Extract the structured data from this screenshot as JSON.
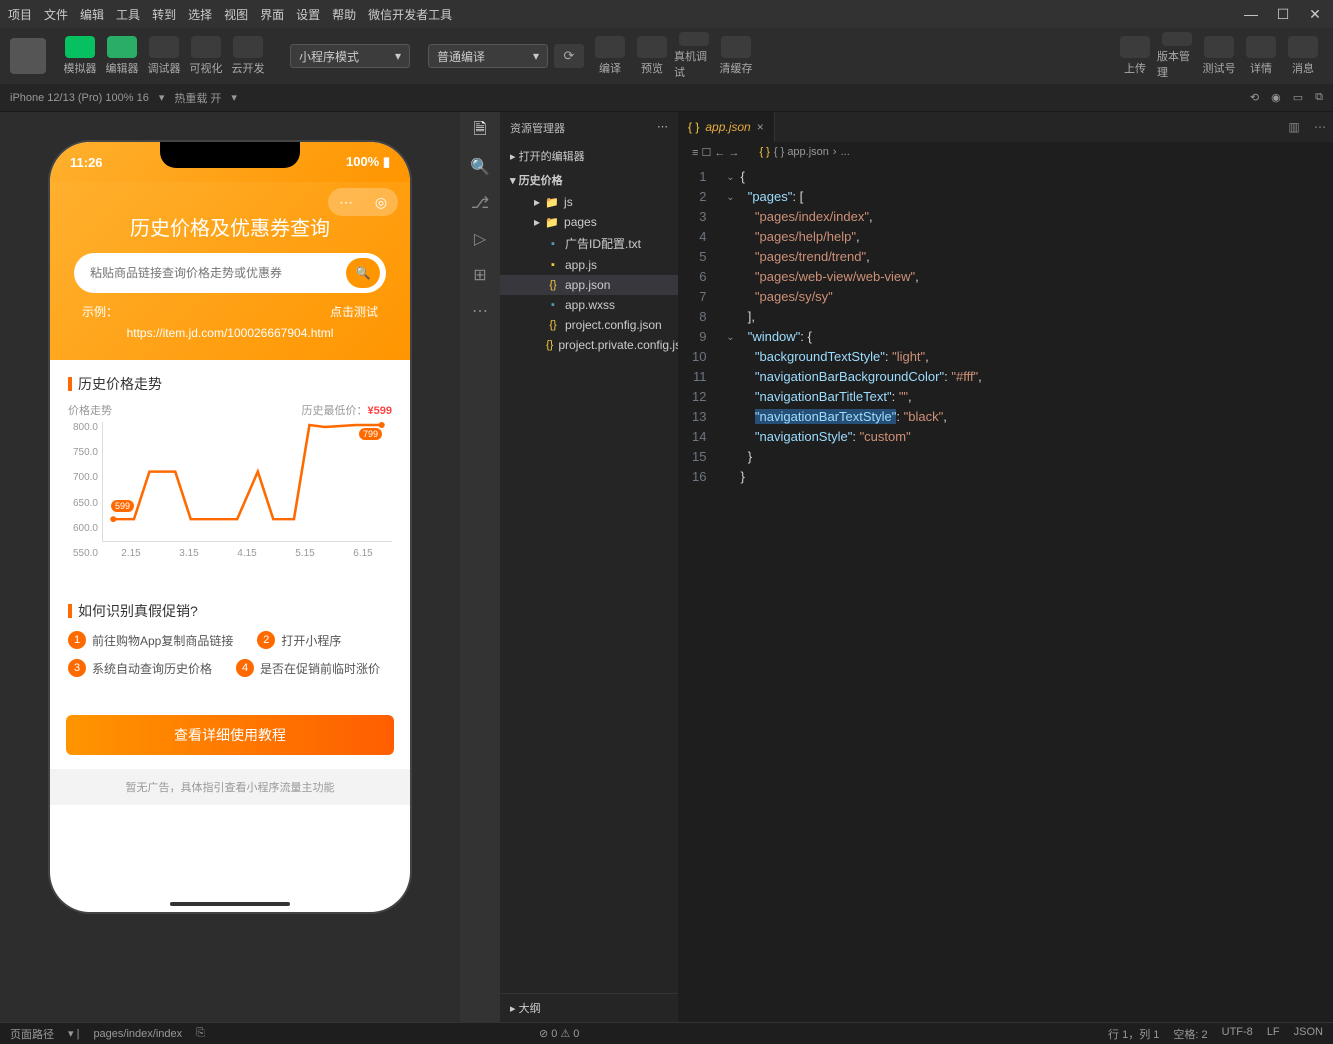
{
  "menu": [
    "项目",
    "文件",
    "编辑",
    "工具",
    "转到",
    "选择",
    "视图",
    "界面",
    "设置",
    "帮助",
    "微信开发者工具"
  ],
  "toolbar": {
    "buttons": [
      {
        "label": "模拟器",
        "cls": "green"
      },
      {
        "label": "编辑器",
        "cls": "green2"
      },
      {
        "label": "调试器",
        "cls": "dim"
      },
      {
        "label": "可视化",
        "cls": "dim"
      },
      {
        "label": "云开发",
        "cls": "dim"
      }
    ],
    "mode": "小程序模式",
    "compile": "普通编译",
    "actions": [
      {
        "label": "编译"
      },
      {
        "label": "预览"
      },
      {
        "label": "真机调试"
      },
      {
        "label": "清缓存"
      }
    ],
    "right": [
      {
        "label": "上传"
      },
      {
        "label": "版本管理"
      },
      {
        "label": "测试号"
      },
      {
        "label": "详情"
      },
      {
        "label": "消息"
      }
    ]
  },
  "subbar": {
    "device": "iPhone 12/13 (Pro) 100% 16",
    "reload": "热重载 开"
  },
  "simulator": {
    "time": "11:26",
    "battery": "100%",
    "title": "历史价格及优惠券查询",
    "search_placeholder": "粘贴商品链接查询价格走势或优惠券",
    "example_label": "示例：",
    "test_btn": "点击测试",
    "example_url": "https://item.jd.com/100026667904.html",
    "card1_title": "历史价格走势",
    "chart_title": "价格走势",
    "chart_min_label": "历史最低价：",
    "chart_min_price": "¥599",
    "card2_title": "如何识别真假促销?",
    "steps": [
      "前往购物App复制商品链接",
      "打开小程序",
      "系统自动查询历史价格",
      "是否在促销前临时涨价"
    ],
    "detail_btn": "查看详细使用教程",
    "ad_note": "暂无广告，具体指引查看小程序流量主功能"
  },
  "chart_data": {
    "type": "line",
    "title": "价格走势",
    "ylabel": "价格",
    "ylim": [
      550,
      800
    ],
    "categories": [
      "2.15",
      "3.15",
      "4.15",
      "5.15",
      "6.15"
    ],
    "values": [
      599,
      700,
      700,
      600,
      600,
      600,
      700,
      600,
      600,
      800,
      799,
      800,
      800
    ],
    "lowest": 599,
    "last": 799,
    "annotations": [
      {
        "label": "599",
        "x": 0,
        "y": 599
      },
      {
        "label": "799",
        "x": 11,
        "y": 799
      }
    ],
    "y_ticks": [
      "800.0",
      "750.0",
      "700.0",
      "650.0",
      "600.0",
      "550.0"
    ]
  },
  "explorer": {
    "title": "资源管理器",
    "sections": [
      "打开的编辑器",
      "历史价格"
    ],
    "tree": [
      {
        "label": "js",
        "icon": "folder-y",
        "indent": "indent1",
        "chev": "▸"
      },
      {
        "label": "pages",
        "icon": "folder-o",
        "indent": "indent1",
        "chev": "▸"
      },
      {
        "label": "广告ID配置.txt",
        "icon": "txt",
        "indent": "indent2"
      },
      {
        "label": "app.js",
        "icon": "js",
        "indent": "indent2"
      },
      {
        "label": "app.json",
        "icon": "json",
        "indent": "indent2",
        "active": true
      },
      {
        "label": "app.wxss",
        "icon": "wxss",
        "indent": "indent2"
      },
      {
        "label": "project.config.json",
        "icon": "json",
        "indent": "indent2"
      },
      {
        "label": "project.private.config.js...",
        "icon": "json",
        "indent": "indent2"
      }
    ],
    "outline": "大纲"
  },
  "editor": {
    "tab": "app.json",
    "breadcrumb": [
      "{ } app.json",
      "..."
    ],
    "code": [
      {
        "n": 1,
        "indent": 0,
        "tokens": [
          {
            "t": "brace",
            "v": "{"
          }
        ]
      },
      {
        "n": 2,
        "indent": 1,
        "tokens": [
          {
            "t": "key",
            "v": "\"pages\""
          },
          {
            "t": "punc",
            "v": ": ["
          }
        ]
      },
      {
        "n": 3,
        "indent": 2,
        "tokens": [
          {
            "t": "str",
            "v": "\"pages/index/index\""
          },
          {
            "t": "punc",
            "v": ","
          }
        ]
      },
      {
        "n": 4,
        "indent": 2,
        "tokens": [
          {
            "t": "str",
            "v": "\"pages/help/help\""
          },
          {
            "t": "punc",
            "v": ","
          }
        ]
      },
      {
        "n": 5,
        "indent": 2,
        "tokens": [
          {
            "t": "str",
            "v": "\"pages/trend/trend\""
          },
          {
            "t": "punc",
            "v": ","
          }
        ]
      },
      {
        "n": 6,
        "indent": 2,
        "tokens": [
          {
            "t": "str",
            "v": "\"pages/web-view/web-view\""
          },
          {
            "t": "punc",
            "v": ","
          }
        ]
      },
      {
        "n": 7,
        "indent": 2,
        "tokens": [
          {
            "t": "str",
            "v": "\"pages/sy/sy\""
          }
        ]
      },
      {
        "n": 8,
        "indent": 1,
        "tokens": [
          {
            "t": "punc",
            "v": "],"
          }
        ]
      },
      {
        "n": 9,
        "indent": 1,
        "tokens": [
          {
            "t": "key",
            "v": "\"window\""
          },
          {
            "t": "punc",
            "v": ": {"
          }
        ]
      },
      {
        "n": 10,
        "indent": 2,
        "tokens": [
          {
            "t": "key",
            "v": "\"backgroundTextStyle\""
          },
          {
            "t": "punc",
            "v": ": "
          },
          {
            "t": "str",
            "v": "\"light\""
          },
          {
            "t": "punc",
            "v": ","
          }
        ]
      },
      {
        "n": 11,
        "indent": 2,
        "tokens": [
          {
            "t": "key",
            "v": "\"navigationBarBackgroundColor\""
          },
          {
            "t": "punc",
            "v": ": "
          },
          {
            "t": "str",
            "v": "\"#fff\""
          },
          {
            "t": "punc",
            "v": ","
          }
        ]
      },
      {
        "n": 12,
        "indent": 2,
        "tokens": [
          {
            "t": "key",
            "v": "\"navigationBarTitleText\""
          },
          {
            "t": "punc",
            "v": ": "
          },
          {
            "t": "str",
            "v": "\"\""
          },
          {
            "t": "punc",
            "v": ","
          }
        ]
      },
      {
        "n": 13,
        "indent": 2,
        "tokens": [
          {
            "t": "key",
            "v": "\"navigationBarTextStyle\"",
            "hl": true
          },
          {
            "t": "punc",
            "v": ": "
          },
          {
            "t": "str",
            "v": "\"black\""
          },
          {
            "t": "punc",
            "v": ","
          }
        ]
      },
      {
        "n": 14,
        "indent": 2,
        "tokens": [
          {
            "t": "key",
            "v": "\"navigationStyle\""
          },
          {
            "t": "punc",
            "v": ": "
          },
          {
            "t": "str",
            "v": "\"custom\""
          }
        ]
      },
      {
        "n": 15,
        "indent": 1,
        "tokens": [
          {
            "t": "punc",
            "v": "}"
          }
        ]
      },
      {
        "n": 16,
        "indent": 0,
        "tokens": [
          {
            "t": "brace",
            "v": "}"
          }
        ]
      }
    ]
  },
  "statusbar": {
    "page_path_label": "页面路径",
    "page_path": "pages/index/index",
    "errors": "⊘ 0 ⚠ 0",
    "right": [
      "行 1，列 1",
      "空格: 2",
      "UTF-8",
      "LF",
      "JSON"
    ]
  }
}
